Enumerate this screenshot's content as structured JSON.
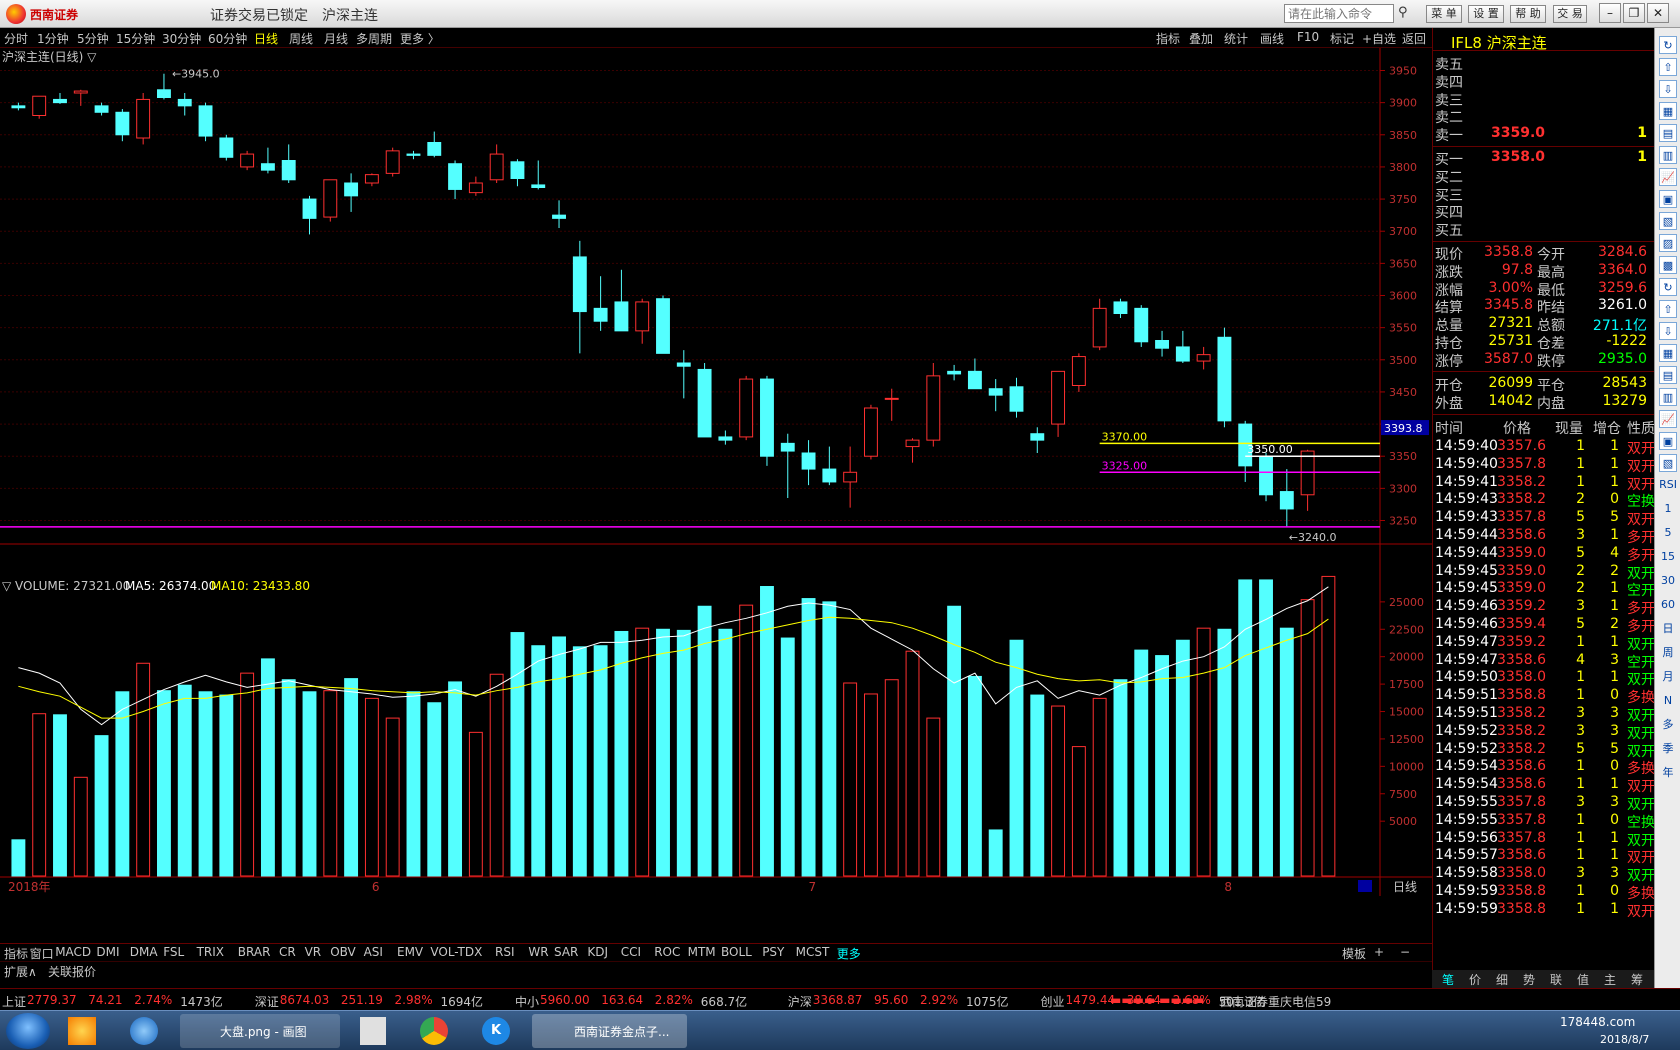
{
  "window": {
    "logo_text": "西南证券",
    "lock_status": "证券交易已锁定",
    "instrument_title": "沪深主连",
    "command_placeholder": "请在此输入命令",
    "menu_buttons": [
      "菜 单",
      "设 置",
      "帮 助",
      "交 易"
    ]
  },
  "periods": [
    "分时",
    "1分钟",
    "5分钟",
    "15分钟",
    "30分钟",
    "60分钟",
    "日线",
    "周线",
    "月线",
    "多周期",
    "更多 〉"
  ],
  "active_period": "日线",
  "chart_tools": [
    "指标",
    "叠加",
    "统计",
    "画线",
    "F10",
    "标记",
    "+自选",
    "返回"
  ],
  "main_chart": {
    "label": "沪深主连(日线) ▽",
    "y_ticks": [
      3950,
      3900,
      3850,
      3800,
      3750,
      3700,
      3650,
      3600,
      3550,
      3500,
      3450,
      3400,
      3350,
      3300,
      3250
    ],
    "y_min": 3215,
    "y_max": 3985,
    "high_label": "3945.0",
    "low_label": "3240.0",
    "current_marker": "3393.8",
    "annotation_lines": [
      {
        "label": "3370.00",
        "value": 3370,
        "color": "#ffff00"
      },
      {
        "label": "3350.00",
        "value": 3350,
        "color": "#ffffff"
      },
      {
        "label": "3325.00",
        "value": 3325,
        "color": "#ff00ff"
      }
    ],
    "support_line": 3240,
    "candles": [
      {
        "o": 3895,
        "h": 3900,
        "l": 3888,
        "c": 3892
      },
      {
        "o": 3880,
        "h": 3905,
        "l": 3875,
        "c": 3910
      },
      {
        "o": 3905,
        "h": 3915,
        "l": 3898,
        "c": 3900
      },
      {
        "o": 3915,
        "h": 3920,
        "l": 3895,
        "c": 3918
      },
      {
        "o": 3895,
        "h": 3900,
        "l": 3880,
        "c": 3885
      },
      {
        "o": 3885,
        "h": 3890,
        "l": 3840,
        "c": 3850
      },
      {
        "o": 3845,
        "h": 3915,
        "l": 3835,
        "c": 3905
      },
      {
        "o": 3920,
        "h": 3945,
        "l": 3905,
        "c": 3908
      },
      {
        "o": 3905,
        "h": 3915,
        "l": 3880,
        "c": 3895
      },
      {
        "o": 3895,
        "h": 3900,
        "l": 3840,
        "c": 3848
      },
      {
        "o": 3845,
        "h": 3850,
        "l": 3810,
        "c": 3815
      },
      {
        "o": 3800,
        "h": 3825,
        "l": 3795,
        "c": 3820
      },
      {
        "o": 3805,
        "h": 3830,
        "l": 3790,
        "c": 3795
      },
      {
        "o": 3810,
        "h": 3835,
        "l": 3775,
        "c": 3780
      },
      {
        "o": 3750,
        "h": 3755,
        "l": 3695,
        "c": 3720
      },
      {
        "o": 3722,
        "h": 3780,
        "l": 3715,
        "c": 3780
      },
      {
        "o": 3775,
        "h": 3790,
        "l": 3730,
        "c": 3755
      },
      {
        "o": 3775,
        "h": 3790,
        "l": 3770,
        "c": 3788
      },
      {
        "o": 3790,
        "h": 3830,
        "l": 3785,
        "c": 3825
      },
      {
        "o": 3820,
        "h": 3825,
        "l": 3812,
        "c": 3818
      },
      {
        "o": 3838,
        "h": 3855,
        "l": 3815,
        "c": 3818
      },
      {
        "o": 3805,
        "h": 3810,
        "l": 3750,
        "c": 3765
      },
      {
        "o": 3760,
        "h": 3785,
        "l": 3755,
        "c": 3775
      },
      {
        "o": 3780,
        "h": 3835,
        "l": 3775,
        "c": 3820
      },
      {
        "o": 3808,
        "h": 3812,
        "l": 3770,
        "c": 3782
      },
      {
        "o": 3772,
        "h": 3810,
        "l": 3765,
        "c": 3768
      },
      {
        "o": 3725,
        "h": 3748,
        "l": 3705,
        "c": 3720
      },
      {
        "o": 3660,
        "h": 3685,
        "l": 3510,
        "c": 3575
      },
      {
        "o": 3580,
        "h": 3630,
        "l": 3545,
        "c": 3560
      },
      {
        "o": 3590,
        "h": 3640,
        "l": 3545,
        "c": 3545
      },
      {
        "o": 3545,
        "h": 3595,
        "l": 3525,
        "c": 3590
      },
      {
        "o": 3595,
        "h": 3600,
        "l": 3510,
        "c": 3510
      },
      {
        "o": 3495,
        "h": 3515,
        "l": 3440,
        "c": 3490
      },
      {
        "o": 3485,
        "h": 3495,
        "l": 3380,
        "c": 3380
      },
      {
        "o": 3380,
        "h": 3390,
        "l": 3368,
        "c": 3375
      },
      {
        "o": 3380,
        "h": 3475,
        "l": 3375,
        "c": 3470
      },
      {
        "o": 3470,
        "h": 3475,
        "l": 3335,
        "c": 3350
      },
      {
        "o": 3370,
        "h": 3385,
        "l": 3285,
        "c": 3358
      },
      {
        "o": 3355,
        "h": 3375,
        "l": 3305,
        "c": 3330
      },
      {
        "o": 3330,
        "h": 3365,
        "l": 3305,
        "c": 3310
      },
      {
        "o": 3310,
        "h": 3365,
        "l": 3270,
        "c": 3325
      },
      {
        "o": 3350,
        "h": 3430,
        "l": 3345,
        "c": 3425
      },
      {
        "o": 3440,
        "h": 3455,
        "l": 3405,
        "c": 3440
      },
      {
        "o": 3365,
        "h": 3378,
        "l": 3340,
        "c": 3375
      },
      {
        "o": 3375,
        "h": 3495,
        "l": 3365,
        "c": 3475
      },
      {
        "o": 3482,
        "h": 3492,
        "l": 3468,
        "c": 3478
      },
      {
        "o": 3482,
        "h": 3502,
        "l": 3455,
        "c": 3455
      },
      {
        "o": 3455,
        "h": 3470,
        "l": 3420,
        "c": 3445
      },
      {
        "o": 3458,
        "h": 3472,
        "l": 3410,
        "c": 3420
      },
      {
        "o": 3385,
        "h": 3395,
        "l": 3355,
        "c": 3375
      },
      {
        "o": 3400,
        "h": 3478,
        "l": 3380,
        "c": 3482
      },
      {
        "o": 3460,
        "h": 3510,
        "l": 3450,
        "c": 3505
      },
      {
        "o": 3520,
        "h": 3595,
        "l": 3515,
        "c": 3580
      },
      {
        "o": 3590,
        "h": 3595,
        "l": 3565,
        "c": 3572
      },
      {
        "o": 3580,
        "h": 3585,
        "l": 3520,
        "c": 3528
      },
      {
        "o": 3530,
        "h": 3545,
        "l": 3505,
        "c": 3518
      },
      {
        "o": 3520,
        "h": 3545,
        "l": 3495,
        "c": 3498
      },
      {
        "o": 3498,
        "h": 3520,
        "l": 3485,
        "c": 3508
      },
      {
        "o": 3535,
        "h": 3550,
        "l": 3395,
        "c": 3405
      },
      {
        "o": 3400,
        "h": 3405,
        "l": 3310,
        "c": 3335
      },
      {
        "o": 3350,
        "h": 3355,
        "l": 3280,
        "c": 3290
      },
      {
        "o": 3295,
        "h": 3330,
        "l": 3240,
        "c": 3268
      },
      {
        "o": 3290,
        "h": 3360,
        "l": 3265,
        "c": 3358
      }
    ]
  },
  "volume_chart": {
    "label": "▽ VOLUME: 27321.00",
    "ma5_label": "MA5: 26374.00",
    "ma10_label": "MA10: 23433.80",
    "y_ticks": [
      25000,
      22500,
      20000,
      17500,
      15000,
      12500,
      10000,
      7500,
      5000
    ],
    "y_max": 29000,
    "volumes": [
      3300,
      14800,
      14600,
      14700,
      9000,
      12800,
      16800,
      19400,
      16900,
      14500,
      17400,
      16800,
      16500,
      18500,
      19800,
      19800,
      17900,
      17700,
      16800,
      16900,
      18000,
      16200,
      14400,
      16800,
      15800,
      17700,
      13100,
      18400,
      22200,
      21000,
      21800,
      20900,
      21000,
      22300,
      22600,
      22500,
      22600,
      22400,
      24600,
      22500,
      24700,
      26400,
      21700,
      25300,
      25000,
      17600,
      16600,
      17900,
      16200,
      16000,
      14400,
      24600,
      18200,
      12600,
      6100,
      10800,
      14500,
      15800,
      11800,
      28900,
      23300,
      28800,
      23000,
      20600,
      22600,
      22500,
      22100,
      20700,
      19900,
      21000,
      26300,
      23900,
      28900
    ],
    "bars": [
      3300,
      14800,
      14700,
      9000,
      12800,
      16800,
      19400,
      16900,
      17400,
      16800,
      16500,
      18500,
      19800,
      17900,
      16800,
      16900,
      18000,
      16200,
      14400,
      16800,
      15800,
      17700,
      13100,
      18400,
      22200,
      21000,
      21800,
      20900,
      21000,
      22300,
      22600,
      22500,
      22400,
      24600,
      22500,
      24700,
      26400,
      21700,
      25300,
      25000,
      17600,
      16600,
      17900,
      20500,
      14400,
      24600,
      18200,
      4200,
      21500,
      16500,
      15500,
      11800,
      16200,
      17900,
      20600,
      20100,
      21500,
      22600,
      22500,
      27000,
      27000,
      22600,
      25200,
      27321
    ],
    "ma5": [
      19000,
      18500,
      17600,
      15200,
      13800,
      15200,
      16100,
      17000,
      17700,
      18300,
      17700,
      17200,
      17500,
      17800,
      17400,
      17000,
      16800,
      16600,
      16300,
      16400,
      16600,
      17000,
      16400,
      17300,
      18400,
      19600,
      20200,
      20700,
      21300,
      21300,
      21500,
      21800,
      21900,
      22600,
      23100,
      23500,
      24000,
      24600,
      24900,
      24700,
      24300,
      22600,
      21600,
      20600,
      18900,
      17600,
      18500,
      15700,
      17200,
      17800,
      16200,
      16900,
      16500,
      17400,
      18100,
      18900,
      19600,
      20000,
      20900,
      22500,
      23400,
      24400,
      25100,
      26374
    ],
    "ma10": [
      17300,
      16800,
      16400,
      15400,
      14400,
      14400,
      15000,
      15700,
      16200,
      16200,
      16500,
      16700,
      17100,
      17200,
      17300,
      17200,
      17100,
      16900,
      16800,
      16700,
      16800,
      16700,
      16500,
      16900,
      17200,
      17700,
      18000,
      18400,
      18800,
      19400,
      19900,
      20300,
      20600,
      21200,
      21600,
      22100,
      22500,
      22900,
      23300,
      23600,
      23500,
      23300,
      23100,
      22600,
      21900,
      21100,
      20400,
      19500,
      19000,
      18400,
      18000,
      17800,
      17900,
      17600,
      17700,
      18000,
      18100,
      18500,
      19000,
      20100,
      20800,
      21500,
      22100,
      23433.8
    ]
  },
  "x_axis": {
    "labels": [
      "2018年",
      "6",
      "7",
      "8"
    ],
    "period_label": "日线"
  },
  "indicator_tabs": [
    "指标",
    "窗口",
    "MACD",
    "DMI",
    "DMA",
    "FSL",
    "TRIX",
    "BRAR",
    "CR",
    "VR",
    "OBV",
    "ASI",
    "EMV",
    "VOL-TDX",
    "RSI",
    "WR",
    "SAR",
    "KDJ",
    "CCI",
    "ROC",
    "MTM",
    "BOLL",
    "PSY",
    "MCST",
    "更多"
  ],
  "tabbar_right": [
    "模板",
    "+",
    "−"
  ],
  "bottom_tabs": [
    "扩展∧",
    "关联报价"
  ],
  "quote_panel": {
    "title": "IFL8 沪深主连",
    "asks": [
      {
        "label": "卖五",
        "price": "",
        "vol": ""
      },
      {
        "label": "卖四",
        "price": "",
        "vol": ""
      },
      {
        "label": "卖三",
        "price": "",
        "vol": ""
      },
      {
        "label": "卖二",
        "price": "",
        "vol": ""
      },
      {
        "label": "卖一",
        "price": "3359.0",
        "vol": "1"
      }
    ],
    "bids": [
      {
        "label": "买一",
        "price": "3358.0",
        "vol": "1"
      },
      {
        "label": "买二",
        "price": "",
        "vol": ""
      },
      {
        "label": "买三",
        "price": "",
        "vol": ""
      },
      {
        "label": "买四",
        "price": "",
        "vol": ""
      },
      {
        "label": "买五",
        "price": "",
        "vol": ""
      }
    ],
    "stats": [
      {
        "l1": "现价",
        "v1": "3358.8",
        "l2": "今开",
        "v2": "3284.6",
        "c1": "#ff3030",
        "c2": "#ff3030"
      },
      {
        "l1": "涨跌",
        "v1": "97.8",
        "l2": "最高",
        "v2": "3364.0",
        "c1": "#ff3030",
        "c2": "#ff3030"
      },
      {
        "l1": "涨幅",
        "v1": "3.00%",
        "l2": "最低",
        "v2": "3259.6",
        "c1": "#ff3030",
        "c2": "#ff3030"
      },
      {
        "l1": "结算",
        "v1": "3345.8",
        "l2": "昨结",
        "v2": "3261.0",
        "c1": "#ff3030",
        "c2": "#ffffff"
      },
      {
        "l1": "总量",
        "v1": "27321",
        "l2": "总额",
        "v2": "271.1亿",
        "c1": "#ffff00",
        "c2": "#00ffff"
      },
      {
        "l1": "持仓",
        "v1": "25731",
        "l2": "仓差",
        "v2": "-1222",
        "c1": "#ffff00",
        "c2": "#ffff00"
      },
      {
        "l1": "涨停",
        "v1": "3587.0",
        "l2": "跌停",
        "v2": "2935.0",
        "c1": "#ff3030",
        "c2": "#00ff00"
      }
    ],
    "stats2": [
      {
        "l1": "开仓",
        "v1": "26099",
        "l2": "平仓",
        "v2": "28543"
      },
      {
        "l1": "外盘",
        "v1": "14042",
        "l2": "内盘",
        "v2": "13279"
      }
    ],
    "trade_headers": [
      "时间",
      "价格",
      "现量",
      "增仓",
      "性质"
    ],
    "trades": [
      {
        "t": "14:59:40",
        "p": "3357.6",
        "v": "1",
        "d": "1",
        "n": "双开",
        "nc": "#ff3030"
      },
      {
        "t": "14:59:40",
        "p": "3357.8",
        "v": "1",
        "d": "1",
        "n": "双开",
        "nc": "#ff3030"
      },
      {
        "t": "14:59:41",
        "p": "3358.2",
        "v": "1",
        "d": "1",
        "n": "双开",
        "nc": "#ff3030"
      },
      {
        "t": "14:59:43",
        "p": "3358.2",
        "v": "2",
        "d": "0",
        "n": "空换",
        "nc": "#00ff00"
      },
      {
        "t": "14:59:43",
        "p": "3357.8",
        "v": "5",
        "d": "5",
        "n": "双开",
        "nc": "#ff3030"
      },
      {
        "t": "14:59:44",
        "p": "3358.6",
        "v": "3",
        "d": "1",
        "n": "多开",
        "nc": "#ff3030"
      },
      {
        "t": "14:59:44",
        "p": "3359.0",
        "v": "5",
        "d": "4",
        "n": "多开",
        "nc": "#ff3030"
      },
      {
        "t": "14:59:45",
        "p": "3359.0",
        "v": "2",
        "d": "2",
        "n": "双开",
        "nc": "#00ff00"
      },
      {
        "t": "14:59:45",
        "p": "3359.0",
        "v": "2",
        "d": "1",
        "n": "空开",
        "nc": "#00ff00"
      },
      {
        "t": "14:59:46",
        "p": "3359.2",
        "v": "3",
        "d": "1",
        "n": "多开",
        "nc": "#ff3030"
      },
      {
        "t": "14:59:46",
        "p": "3359.4",
        "v": "5",
        "d": "2",
        "n": "多开",
        "nc": "#ff3030"
      },
      {
        "t": "14:59:47",
        "p": "3359.2",
        "v": "1",
        "d": "1",
        "n": "双开",
        "nc": "#00ff00"
      },
      {
        "t": "14:59:47",
        "p": "3358.6",
        "v": "4",
        "d": "3",
        "n": "空开",
        "nc": "#00ff00"
      },
      {
        "t": "14:59:50",
        "p": "3358.0",
        "v": "1",
        "d": "1",
        "n": "双开",
        "nc": "#00ff00"
      },
      {
        "t": "14:59:51",
        "p": "3358.8",
        "v": "1",
        "d": "0",
        "n": "多换",
        "nc": "#ff3030"
      },
      {
        "t": "14:59:51",
        "p": "3358.2",
        "v": "3",
        "d": "3",
        "n": "双开",
        "nc": "#00ff00"
      },
      {
        "t": "14:59:52",
        "p": "3358.2",
        "v": "3",
        "d": "3",
        "n": "双开",
        "nc": "#00ff00"
      },
      {
        "t": "14:59:52",
        "p": "3358.2",
        "v": "5",
        "d": "5",
        "n": "双开",
        "nc": "#00ff00"
      },
      {
        "t": "14:59:54",
        "p": "3358.6",
        "v": "1",
        "d": "0",
        "n": "多换",
        "nc": "#ff3030"
      },
      {
        "t": "14:59:54",
        "p": "3358.6",
        "v": "1",
        "d": "1",
        "n": "双开",
        "nc": "#ff3030"
      },
      {
        "t": "14:59:55",
        "p": "3357.8",
        "v": "3",
        "d": "3",
        "n": "双开",
        "nc": "#00ff00"
      },
      {
        "t": "14:59:55",
        "p": "3357.8",
        "v": "1",
        "d": "0",
        "n": "空换",
        "nc": "#00ff00"
      },
      {
        "t": "14:59:56",
        "p": "3357.8",
        "v": "1",
        "d": "1",
        "n": "双开",
        "nc": "#00ff00"
      },
      {
        "t": "14:59:57",
        "p": "3358.6",
        "v": "1",
        "d": "1",
        "n": "双开",
        "nc": "#ff3030"
      },
      {
        "t": "14:59:58",
        "p": "3358.0",
        "v": "3",
        "d": "3",
        "n": "双开",
        "nc": "#00ff00"
      },
      {
        "t": "14:59:59",
        "p": "3358.8",
        "v": "1",
        "d": "0",
        "n": "多换",
        "nc": "#ff3030"
      },
      {
        "t": "14:59:59",
        "p": "3358.8",
        "v": "1",
        "d": "1",
        "n": "双开",
        "nc": "#ff3030"
      }
    ],
    "bottom_tabs": [
      "笔",
      "价",
      "细",
      "势",
      "联",
      "值",
      "主",
      "筹"
    ]
  },
  "sidebar_labels": [
    "RSI",
    "1",
    "5",
    "15",
    "30",
    "60",
    "日",
    "周",
    "月",
    "N",
    "多",
    "季",
    "年"
  ],
  "ticker": [
    {
      "name": "上证",
      "price": "2779.37",
      "chg": "74.21",
      "pct": "2.74%",
      "amt": "1473亿"
    },
    {
      "name": "深证",
      "price": "8674.03",
      "chg": "251.19",
      "pct": "2.98%",
      "amt": "1694亿"
    },
    {
      "name": "中小",
      "price": "5960.00",
      "chg": "163.64",
      "pct": "2.82%",
      "amt": "668.7亿"
    },
    {
      "name": "沪深",
      "price": "3368.87",
      "chg": "95.60",
      "pct": "2.92%",
      "amt": "1075亿"
    },
    {
      "name": "创业",
      "price": "1479.44",
      "chg": "38.64",
      "pct": "2.68%",
      "amt": "501.3亿"
    }
  ],
  "ticker_broker": "西南证券重庆电信59",
  "taskbar": {
    "tasks": [
      "大盘.png - 画图",
      "西南证券金点子..."
    ],
    "clock_time": "178448.com",
    "clock_date": "2018/8/7"
  }
}
